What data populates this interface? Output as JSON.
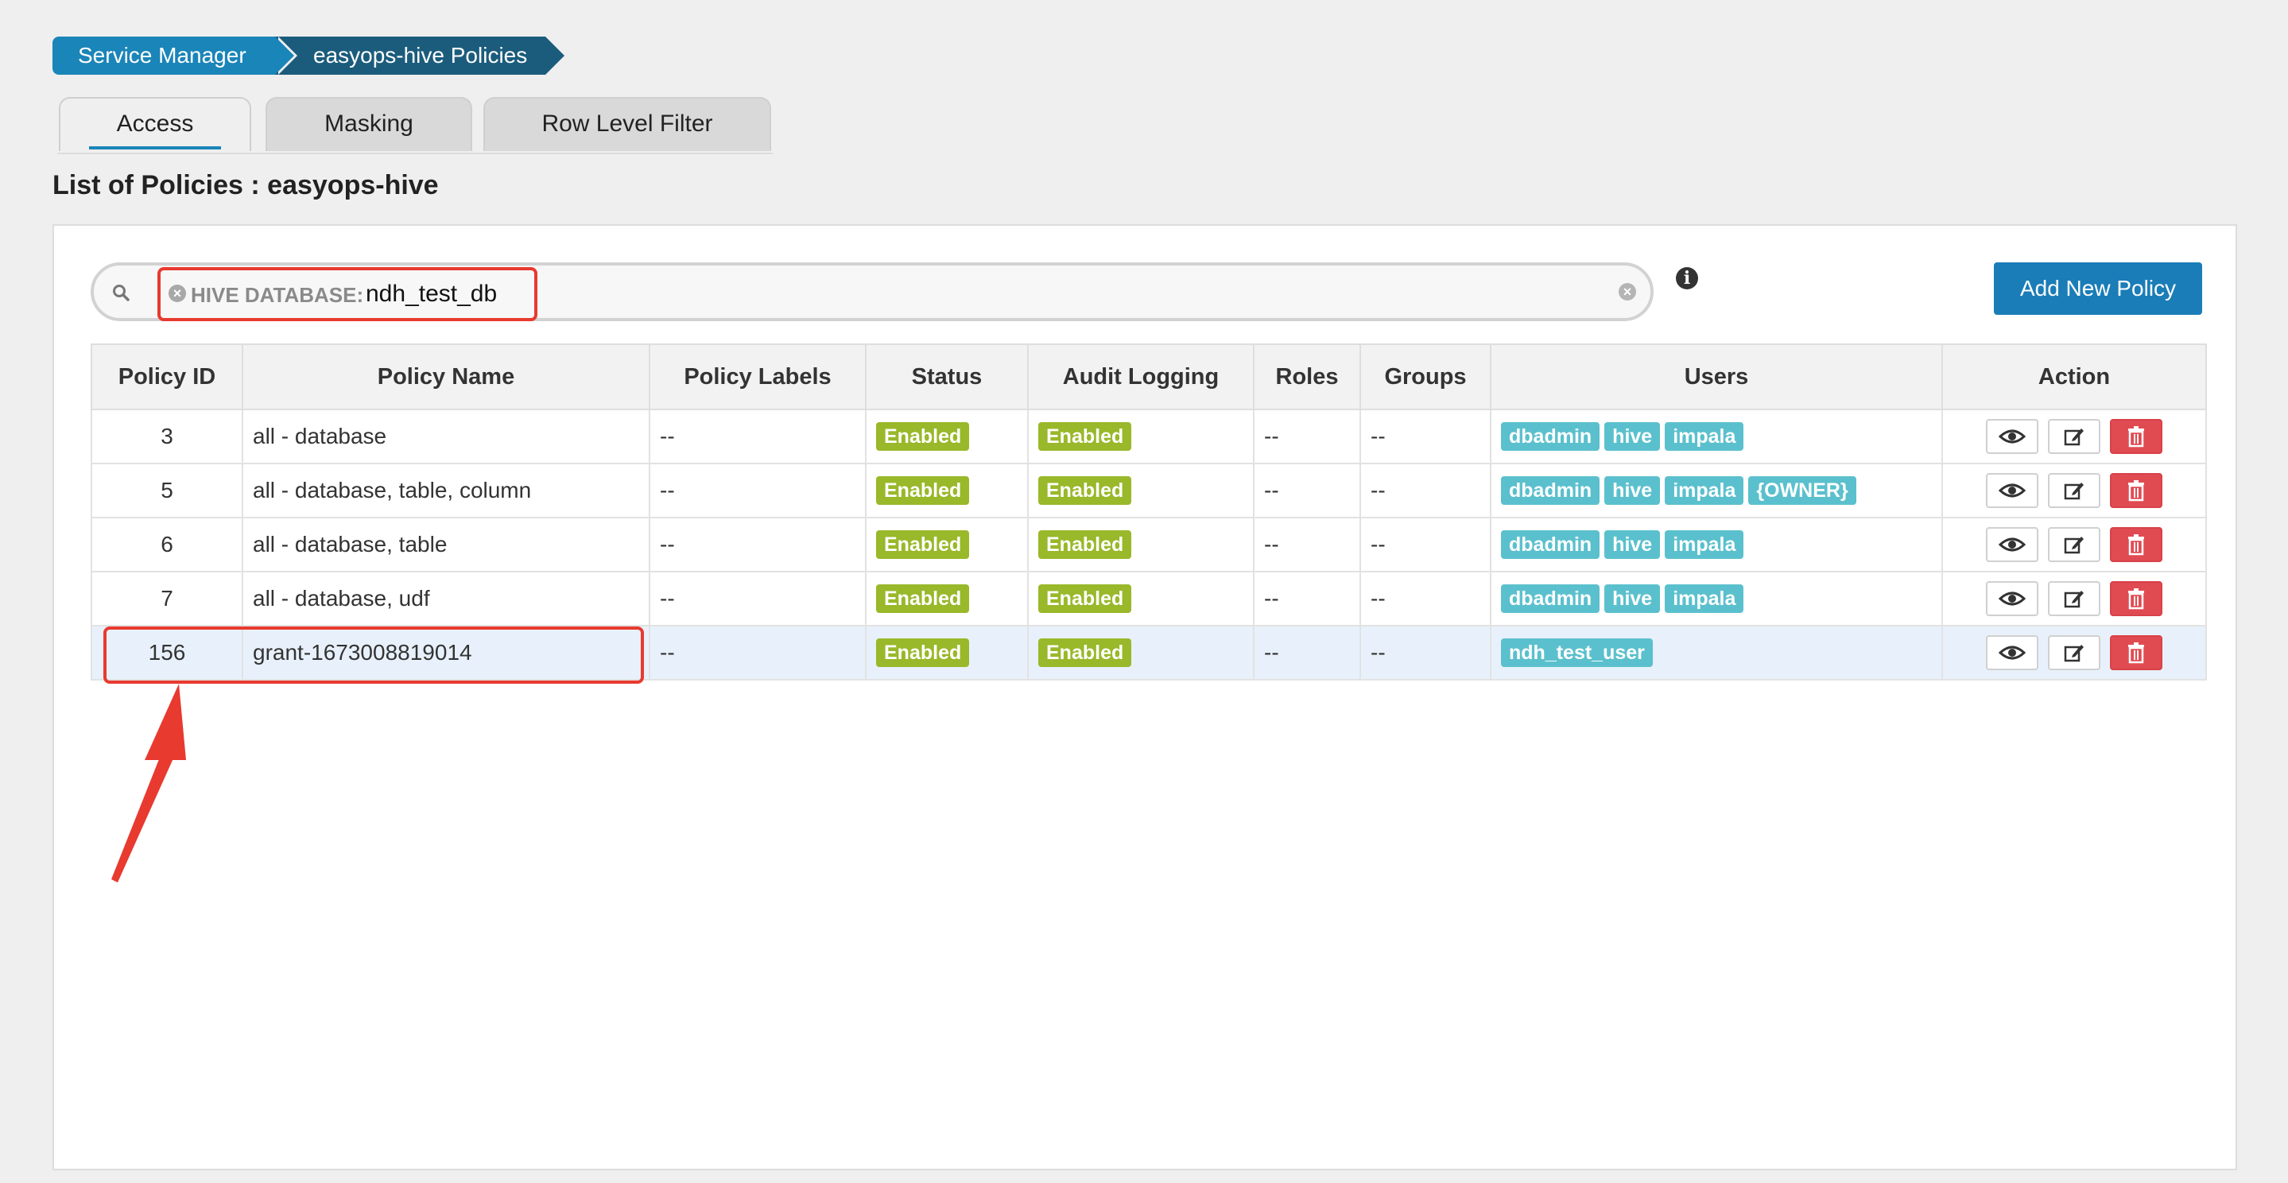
{
  "breadcrumb": {
    "items": [
      "Service Manager",
      "easyops-hive Policies"
    ]
  },
  "tabs": [
    {
      "label": "Access",
      "active": true
    },
    {
      "label": "Masking",
      "active": false
    },
    {
      "label": "Row Level Filter",
      "active": false
    }
  ],
  "page_title": "List of Policies : easyops-hive",
  "search": {
    "filter_label": "HIVE DATABASE:",
    "filter_value": "ndh_test_db"
  },
  "add_button": "Add New Policy",
  "table": {
    "columns": [
      "Policy ID",
      "Policy Name",
      "Policy Labels",
      "Status",
      "Audit Logging",
      "Roles",
      "Groups",
      "Users",
      "Action"
    ],
    "rows": [
      {
        "id": "3",
        "name": "all - database",
        "labels": "--",
        "status": "Enabled",
        "audit": "Enabled",
        "roles": "--",
        "groups": "--",
        "users": [
          "dbadmin",
          "hive",
          "impala"
        ]
      },
      {
        "id": "5",
        "name": "all - database, table, column",
        "labels": "--",
        "status": "Enabled",
        "audit": "Enabled",
        "roles": "--",
        "groups": "--",
        "users": [
          "dbadmin",
          "hive",
          "impala",
          "{OWNER}"
        ]
      },
      {
        "id": "6",
        "name": "all - database, table",
        "labels": "--",
        "status": "Enabled",
        "audit": "Enabled",
        "roles": "--",
        "groups": "--",
        "users": [
          "dbadmin",
          "hive",
          "impala"
        ]
      },
      {
        "id": "7",
        "name": "all - database, udf",
        "labels": "--",
        "status": "Enabled",
        "audit": "Enabled",
        "roles": "--",
        "groups": "--",
        "users": [
          "dbadmin",
          "hive",
          "impala"
        ]
      },
      {
        "id": "156",
        "name": "grant-1673008819014",
        "labels": "--",
        "status": "Enabled",
        "audit": "Enabled",
        "roles": "--",
        "groups": "--",
        "users": [
          "ndh_test_user"
        ],
        "highlighted": true
      }
    ]
  },
  "colors": {
    "primary": "#1a7db8",
    "breadcrumb_dark": "#1b5c7c",
    "enabled_green": "#99b82a",
    "user_teal": "#5bc0cd",
    "delete_red": "#e04b52",
    "annotation_red": "#e83a2f"
  },
  "icons": {
    "view": "eye-icon",
    "edit": "edit-icon",
    "delete": "trash-icon",
    "search": "search-icon",
    "info": "info-icon"
  }
}
